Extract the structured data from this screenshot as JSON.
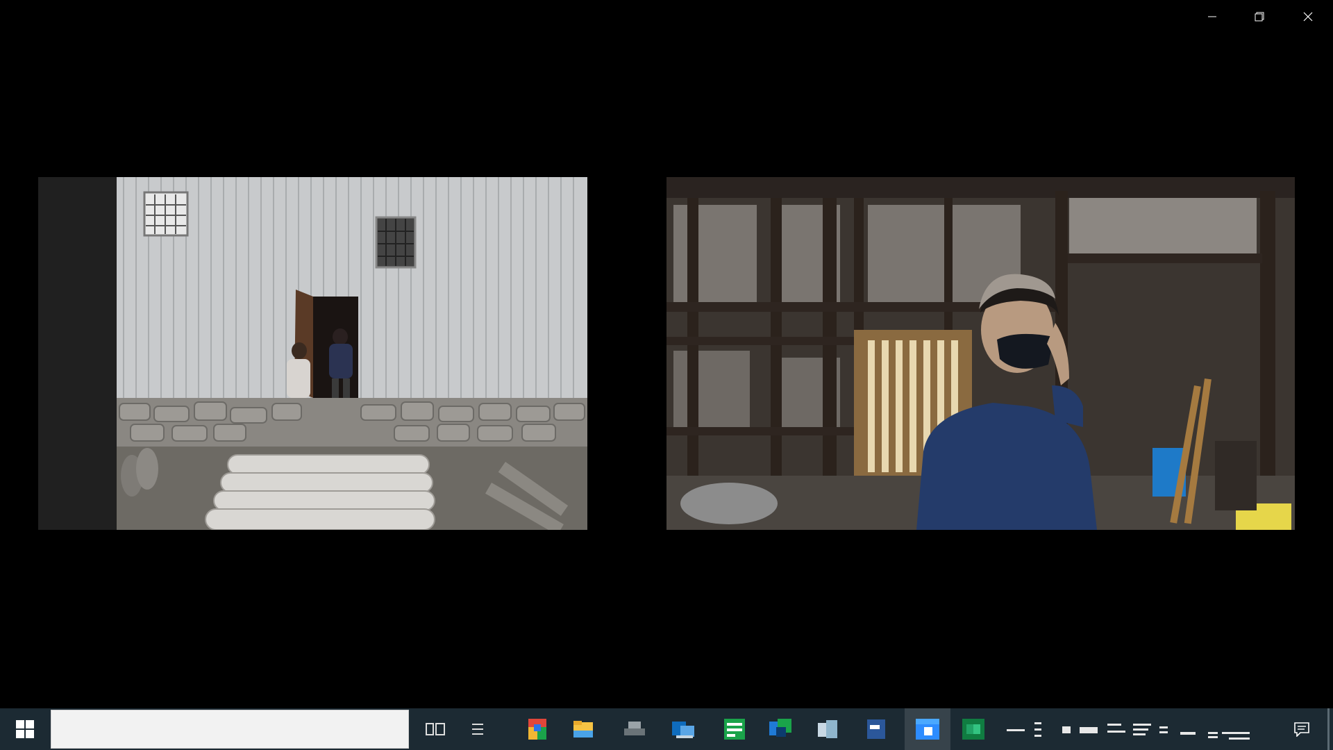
{
  "window": {
    "controls": [
      {
        "name": "minimize",
        "icon": "minimize-icon"
      },
      {
        "name": "restore",
        "icon": "restore-icon"
      },
      {
        "name": "close",
        "icon": "close-icon"
      }
    ]
  },
  "gallery": {
    "tiles": [
      {
        "name": "video-tile-left",
        "scene": "building-exterior-photo"
      },
      {
        "name": "video-tile-right",
        "scene": "person-in-barn-photo"
      }
    ]
  },
  "taskbar": {
    "start_icon": "windows-logo-icon",
    "search_text": "",
    "pinned": [
      {
        "name": "task-view",
        "icon": "task-view-icon"
      },
      {
        "name": "widgets",
        "icon": "widgets-icon"
      },
      {
        "name": "chrome",
        "icon": "browser-icon",
        "color": "#e0463a"
      },
      {
        "name": "file-explorer",
        "icon": "folder-icon",
        "color": "#f6c344"
      },
      {
        "name": "app-gray",
        "icon": "app-icon",
        "color": "#9aa3a8"
      },
      {
        "name": "outlook",
        "icon": "mail-icon",
        "color": "#0f6cbd"
      },
      {
        "name": "app-green",
        "icon": "spreadsheet-icon",
        "color": "#1aa34a"
      },
      {
        "name": "app-teal",
        "icon": "app-icon",
        "color": "#1f7ad6"
      },
      {
        "name": "app-light",
        "icon": "app-icon",
        "color": "#8fb5cc"
      },
      {
        "name": "word",
        "icon": "document-icon",
        "color": "#2b579a"
      },
      {
        "name": "zoom",
        "icon": "video-icon",
        "color": "#2d8cff",
        "active": true
      },
      {
        "name": "excel",
        "icon": "spreadsheet-icon",
        "color": "#107c41"
      }
    ],
    "notification_icon": "notification-icon"
  },
  "colors": {
    "background": "#000000",
    "taskbar": "#1c2a33",
    "tile_bg": "#222222"
  }
}
